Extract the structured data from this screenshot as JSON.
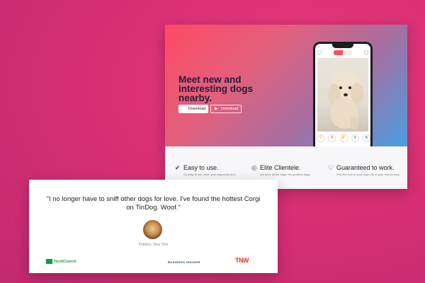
{
  "hero": {
    "title": "Meet new and interesting dogs nearby.",
    "download_primary": "Download",
    "download_secondary": "Download"
  },
  "features": [
    {
      "icon": "check-circle-icon",
      "title": "Easy to use.",
      "desc": "So easy to use, even your dog could do it."
    },
    {
      "icon": "bullseye-icon",
      "title": "Elite Clientele.",
      "desc": "We have all the dogs, the greatest dogs."
    },
    {
      "icon": "heart-icon",
      "title": "Guaranteed to work.",
      "desc": "Find the love of your dog's life or your money back."
    }
  ],
  "testimonial": {
    "quote": "\"I no longer have to sniff other dogs for love. I've found the hottest Corgi on TinDog. Woof.\"",
    "author": "Pebbles, New York"
  },
  "press": {
    "techcrunch": "TechCrunch",
    "business_insider": "BUSINESS INSIDER",
    "tnw": "TNW"
  },
  "colors": {
    "background": "#d92f75",
    "hero_start": "#ff4a63",
    "hero_end": "#4a9ee0",
    "title": "#1e1f3a"
  }
}
